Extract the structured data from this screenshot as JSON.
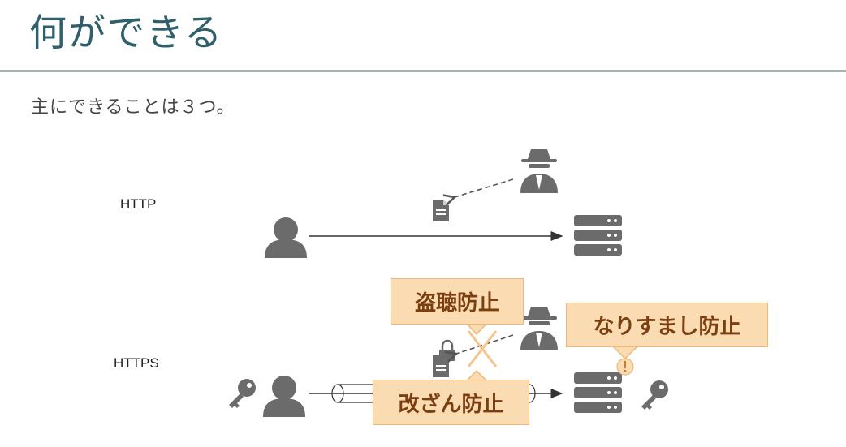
{
  "title": "何ができる",
  "subtitle": "主にできることは３つ。",
  "labels": {
    "http": "HTTP",
    "https": "HTTPS"
  },
  "callouts": {
    "eavesdrop": "盗聴防止",
    "spoofing": "なりすまし防止",
    "tamper": "改ざん防止"
  },
  "colors": {
    "title": "#2f5f6a",
    "icon": "#6b6b6b",
    "callout_fill": "#fbdcb2",
    "callout_border": "#f0b876",
    "callout_text": "#7a3e10"
  },
  "icons": [
    "user-icon",
    "server-icon",
    "spy-icon",
    "document-icon",
    "key-icon",
    "lock-icon",
    "cross-icon",
    "warning-icon"
  ]
}
